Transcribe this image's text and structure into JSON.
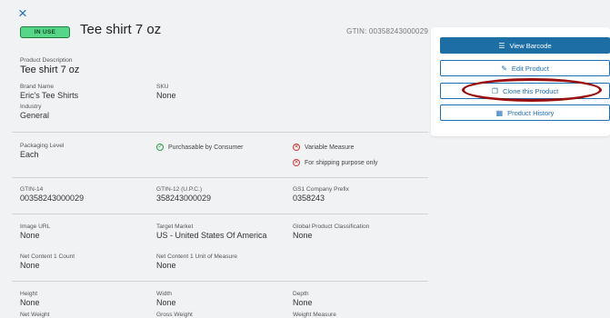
{
  "close_icon": "×",
  "header": {
    "status_badge": "IN USE",
    "title": "Tee shirt 7 oz",
    "gtin_label": "GTIN: 00358243000029"
  },
  "fields": {
    "product_description": {
      "label": "Product Description",
      "value": "Tee shirt 7 oz"
    },
    "brand_name": {
      "label": "Brand Name",
      "value": "Eric's Tee Shirts"
    },
    "sku": {
      "label": "SKU",
      "value": "None"
    },
    "industry": {
      "label": "Industry",
      "value": "General"
    },
    "packaging_level": {
      "label": "Packaging Level",
      "value": "Each"
    },
    "gtin14": {
      "label": "GTIN-14",
      "value": "00358243000029"
    },
    "gtin12": {
      "label": "GTIN-12 (U.P.C.)",
      "value": "358243000029"
    },
    "gs1_prefix": {
      "label": "GS1 Company Prefix",
      "value": "0358243"
    },
    "image_url": {
      "label": "Image URL",
      "value": "None"
    },
    "target_market": {
      "label": "Target Market",
      "value": "US - United States Of America"
    },
    "gpc": {
      "label": "Global Product Classification",
      "value": "None"
    },
    "net_content_count": {
      "label": "Net Content 1 Count",
      "value": "None"
    },
    "net_content_uom": {
      "label": "Net Content 1 Unit of Measure",
      "value": "None"
    },
    "height": {
      "label": "Height",
      "value": "None"
    },
    "width": {
      "label": "Width",
      "value": "None"
    },
    "depth": {
      "label": "Depth",
      "value": "None"
    },
    "net_weight": {
      "label": "Net Weight"
    },
    "gross_weight": {
      "label": "Gross Weight"
    },
    "weight_measure": {
      "label": "Weight Measure"
    }
  },
  "flags": {
    "purchasable": "Purchasable by Consumer",
    "variable_measure": "Variable Measure",
    "shipping_only": "For shipping purpose only"
  },
  "actions": {
    "view_barcode": "View Barcode",
    "edit_product": "Edit Product",
    "clone_product": "Clone this Product",
    "product_history": "Product History"
  },
  "colors": {
    "accent": "#1c6ea4",
    "in_use_badge": "#57d68a",
    "highlight_circle": "#9b0e0e"
  }
}
